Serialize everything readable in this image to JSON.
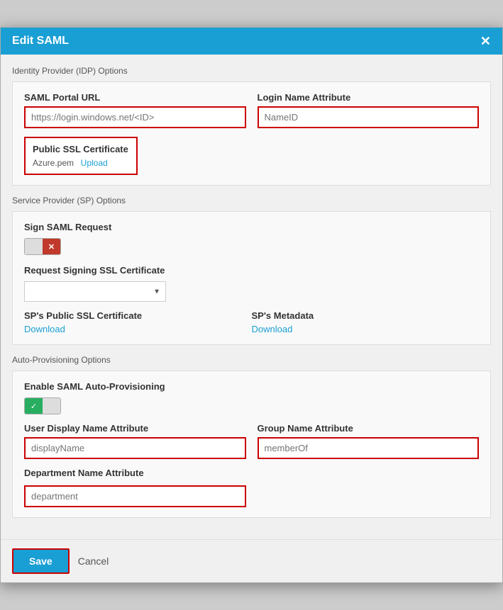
{
  "modal": {
    "title": "Edit SAML",
    "close_label": "✕"
  },
  "idp_section": {
    "label": "Identity Provider (IDP) Options",
    "saml_portal_url": {
      "label": "SAML Portal URL",
      "placeholder": "https://login.windows.net/<ID>",
      "value": ""
    },
    "login_name_attribute": {
      "label": "Login Name Attribute",
      "placeholder": "NameID",
      "value": ""
    },
    "public_ssl_certificate": {
      "label": "Public SSL Certificate",
      "filename": "Azure.pem",
      "upload_label": "Upload"
    }
  },
  "sp_section": {
    "label": "Service Provider (SP) Options",
    "sign_saml_request": {
      "label": "Sign SAML Request",
      "state": "off"
    },
    "request_signing_ssl": {
      "label": "Request Signing SSL Certificate",
      "options": [
        ""
      ]
    },
    "sp_public_ssl": {
      "label": "SP's Public SSL Certificate",
      "download_label": "Download"
    },
    "sp_metadata": {
      "label": "SP's Metadata",
      "download_label": "Download"
    }
  },
  "auto_prov_section": {
    "label": "Auto-Provisioning Options",
    "enable_saml": {
      "label": "Enable SAML Auto-Provisioning",
      "state": "on"
    },
    "user_display_name": {
      "label": "User Display Name Attribute",
      "placeholder": "displayName",
      "value": ""
    },
    "group_name": {
      "label": "Group Name Attribute",
      "placeholder": "memberOf",
      "value": ""
    },
    "department_name": {
      "label": "Department Name Attribute",
      "placeholder": "department",
      "value": ""
    }
  },
  "footer": {
    "save_label": "Save",
    "cancel_label": "Cancel"
  }
}
